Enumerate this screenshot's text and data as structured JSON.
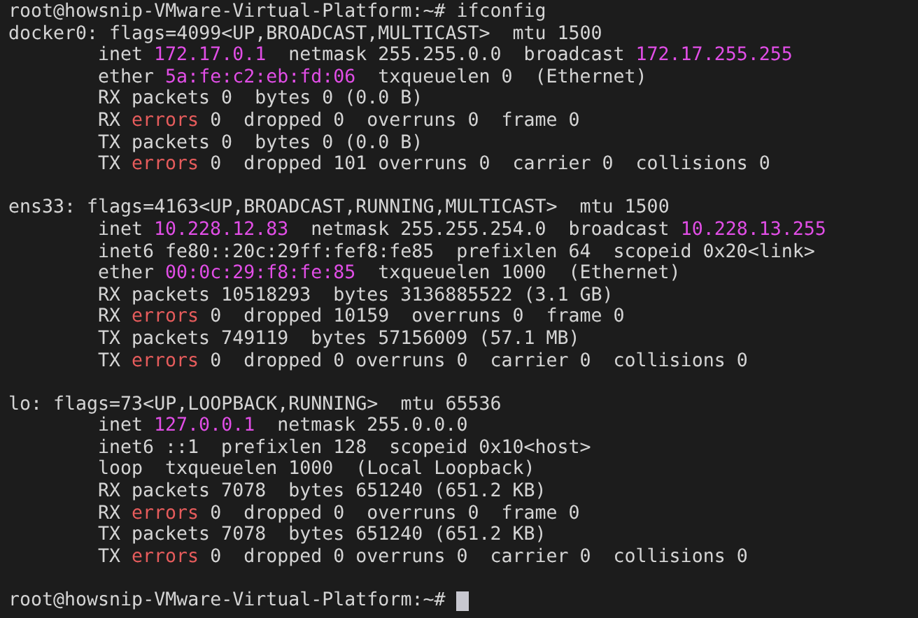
{
  "command_line": {
    "prompt": "root@howsnip-VMware-Virtual-Platform:~#",
    "command": "ifconfig"
  },
  "interfaces": [
    {
      "header": "docker0: flags=4099<UP,BROADCAST,MULTICAST>  mtu 1500",
      "lines": [
        [
          {
            "text": "inet ",
            "kind": "plain"
          },
          {
            "text": "172.17.0.1",
            "kind": "address"
          },
          {
            "text": "  netmask 255.255.0.0  broadcast ",
            "kind": "plain"
          },
          {
            "text": "172.17.255.255",
            "kind": "address"
          }
        ],
        [
          {
            "text": "ether ",
            "kind": "plain"
          },
          {
            "text": "5a:fe:c2:eb:fd:06",
            "kind": "address"
          },
          {
            "text": "  txqueuelen 0  (Ethernet)",
            "kind": "plain"
          }
        ],
        [
          {
            "text": "RX packets 0  bytes 0 (0.0 B)",
            "kind": "plain"
          }
        ],
        [
          {
            "text": "RX ",
            "kind": "plain"
          },
          {
            "text": "errors",
            "kind": "error"
          },
          {
            "text": " 0  dropped 0  overruns 0  frame 0",
            "kind": "plain"
          }
        ],
        [
          {
            "text": "TX packets 0  bytes 0 (0.0 B)",
            "kind": "plain"
          }
        ],
        [
          {
            "text": "TX ",
            "kind": "plain"
          },
          {
            "text": "errors",
            "kind": "error"
          },
          {
            "text": " 0  dropped 101 overruns 0  carrier 0  collisions 0",
            "kind": "plain"
          }
        ]
      ]
    },
    {
      "header": "ens33: flags=4163<UP,BROADCAST,RUNNING,MULTICAST>  mtu 1500",
      "lines": [
        [
          {
            "text": "inet ",
            "kind": "plain"
          },
          {
            "text": "10.228.12.83",
            "kind": "address"
          },
          {
            "text": "  netmask 255.255.254.0  broadcast ",
            "kind": "plain"
          },
          {
            "text": "10.228.13.255",
            "kind": "address"
          }
        ],
        [
          {
            "text": "inet6 fe80::20c:29ff:fef8:fe85  prefixlen 64  scopeid 0x20<link>",
            "kind": "plain"
          }
        ],
        [
          {
            "text": "ether ",
            "kind": "plain"
          },
          {
            "text": "00:0c:29:f8:fe:85",
            "kind": "address"
          },
          {
            "text": "  txqueuelen 1000  (Ethernet)",
            "kind": "plain"
          }
        ],
        [
          {
            "text": "RX packets 10518293  bytes 3136885522 (3.1 GB)",
            "kind": "plain"
          }
        ],
        [
          {
            "text": "RX ",
            "kind": "plain"
          },
          {
            "text": "errors",
            "kind": "error"
          },
          {
            "text": " 0  dropped 10159  overruns 0  frame 0",
            "kind": "plain"
          }
        ],
        [
          {
            "text": "TX packets 749119  bytes 57156009 (57.1 MB)",
            "kind": "plain"
          }
        ],
        [
          {
            "text": "TX ",
            "kind": "plain"
          },
          {
            "text": "errors",
            "kind": "error"
          },
          {
            "text": " 0  dropped 0 overruns 0  carrier 0  collisions 0",
            "kind": "plain"
          }
        ]
      ]
    },
    {
      "header": "lo: flags=73<UP,LOOPBACK,RUNNING>  mtu 65536",
      "lines": [
        [
          {
            "text": "inet ",
            "kind": "plain"
          },
          {
            "text": "127.0.0.1",
            "kind": "address"
          },
          {
            "text": "  netmask 255.0.0.0",
            "kind": "plain"
          }
        ],
        [
          {
            "text": "inet6 ::1  prefixlen 128  scopeid 0x10<host>",
            "kind": "plain"
          }
        ],
        [
          {
            "text": "loop  txqueuelen 1000  (Local Loopback)",
            "kind": "plain"
          }
        ],
        [
          {
            "text": "RX packets 7078  bytes 651240 (651.2 KB)",
            "kind": "plain"
          }
        ],
        [
          {
            "text": "RX ",
            "kind": "plain"
          },
          {
            "text": "errors",
            "kind": "error"
          },
          {
            "text": " 0  dropped 0  overruns 0  frame 0",
            "kind": "plain"
          }
        ],
        [
          {
            "text": "TX packets 7078  bytes 651240 (651.2 KB)",
            "kind": "plain"
          }
        ],
        [
          {
            "text": "TX ",
            "kind": "plain"
          },
          {
            "text": "errors",
            "kind": "error"
          },
          {
            "text": " 0  dropped 0 overruns 0  carrier 0  collisions 0",
            "kind": "plain"
          }
        ]
      ]
    }
  ],
  "final_prompt": {
    "prompt": "root@howsnip-VMware-Virtual-Platform:~#",
    "cursor": true
  }
}
